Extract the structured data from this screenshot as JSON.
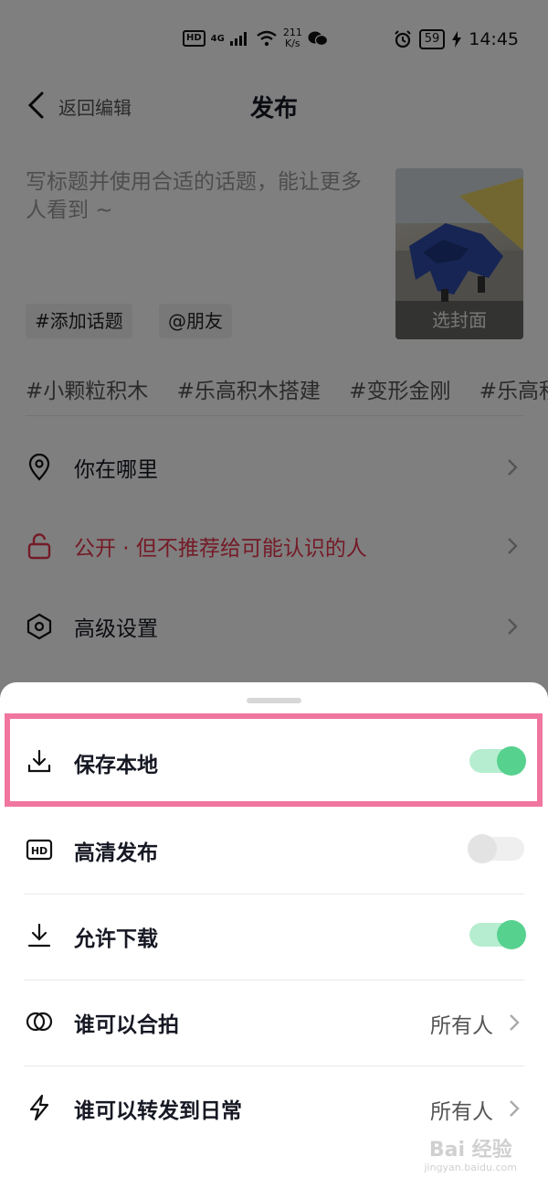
{
  "status_bar": {
    "hd": "HD",
    "network": "4G",
    "speed_value": "211",
    "speed_unit": "K/s",
    "battery": "59",
    "time": "14:45"
  },
  "nav": {
    "back_label": "返回编辑",
    "title": "发布"
  },
  "compose": {
    "placeholder": "写标题并使用合适的话题，能让更多人看到 ~",
    "add_topic": "#添加话题",
    "mention": "@朋友",
    "cover_label": "选封面"
  },
  "hashtags": [
    "#小颗粒积木",
    "#乐高积木搭建",
    "#变形金刚",
    "#乐高积"
  ],
  "menu": {
    "location": "你在哪里",
    "privacy": "公开 · 但不推荐给可能认识的人",
    "privacy_color": "#e8364f",
    "advanced": "高级设置"
  },
  "sheet": {
    "rows": [
      {
        "label": "保存本地",
        "type": "toggle",
        "on": true,
        "icon": "download-icon"
      },
      {
        "label": "高清发布",
        "type": "toggle",
        "on": false,
        "icon": "hd-icon"
      },
      {
        "label": "允许下载",
        "type": "toggle",
        "on": true,
        "icon": "download-icon"
      },
      {
        "label": "谁可以合拍",
        "type": "select",
        "value": "所有人",
        "icon": "duet-icon"
      },
      {
        "label": "谁可以转发到日常",
        "type": "select",
        "value": "所有人",
        "icon": "lightning-icon"
      }
    ],
    "toggle_on_color": "#57d18e",
    "highlight_color": "#f0759f"
  },
  "watermark": {
    "main": "Bai 经验",
    "sub": "jingyan.baidu.com"
  }
}
